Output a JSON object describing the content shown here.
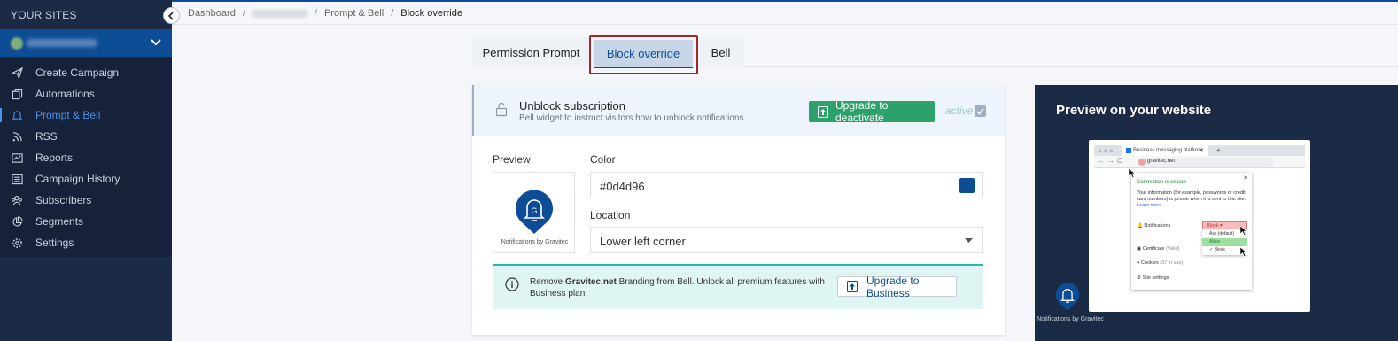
{
  "colors": {
    "brand": "#0d4d96",
    "sidebar": "#1b2b45",
    "success": "#2ca26b",
    "teal": "#2fb7a8"
  },
  "sidebar": {
    "heading": "YOUR SITES",
    "items": [
      {
        "label": "Create Campaign",
        "icon": "paper-plane-icon"
      },
      {
        "label": "Automations",
        "icon": "copy-icon"
      },
      {
        "label": "Prompt & Bell",
        "icon": "bell-icon",
        "active": true
      },
      {
        "label": "RSS",
        "icon": "rss-icon"
      },
      {
        "label": "Reports",
        "icon": "chart-icon"
      },
      {
        "label": "Campaign History",
        "icon": "list-icon"
      },
      {
        "label": "Subscribers",
        "icon": "users-icon"
      },
      {
        "label": "Segments",
        "icon": "pie-icon"
      },
      {
        "label": "Settings",
        "icon": "gear-icon"
      }
    ]
  },
  "breadcrumb": {
    "home": "Dashboard",
    "section": "Prompt & Bell",
    "current": "Block override"
  },
  "tabs": [
    "Permission Prompt",
    "Block override",
    "Bell"
  ],
  "card": {
    "title": "Unblock subscription",
    "subtitle": "Bell widget to instruct visitors how to unblock notifications",
    "upgrade_button": "Upgrade to deactivate",
    "status": "active",
    "preview_label": "Preview",
    "preview_caption": "Notifications by Gravitec",
    "color_label": "Color",
    "color_value": "#0d4d96",
    "location_label": "Location",
    "location_value": "Lower left corner",
    "promo_prefix": "Remove ",
    "promo_brand": "Gravitec.net",
    "promo_suffix": " Branding from Bell. Unlock all premium features with Business plan.",
    "business_button": "Upgrade to Business"
  },
  "preview_panel": {
    "title": "Preview on your website",
    "browser_tab": "Business messaging platform",
    "url": "gravitec.net",
    "connection": "Connection is secure",
    "info": "Your information (for example, passwords or credit card numbers) is private when it is sent to this site.",
    "learn_more": "Learn more",
    "notifications": "Notifications",
    "block": "Block",
    "options": [
      "Ask (default)",
      "Allow",
      "Block"
    ],
    "certificate": "Certificate",
    "certificate_status": "(Valid)",
    "cookies": "Cookies",
    "cookies_count": "(37 in use)",
    "site_settings": "Site settings",
    "bell_caption": "Notifications by Gravitec"
  }
}
